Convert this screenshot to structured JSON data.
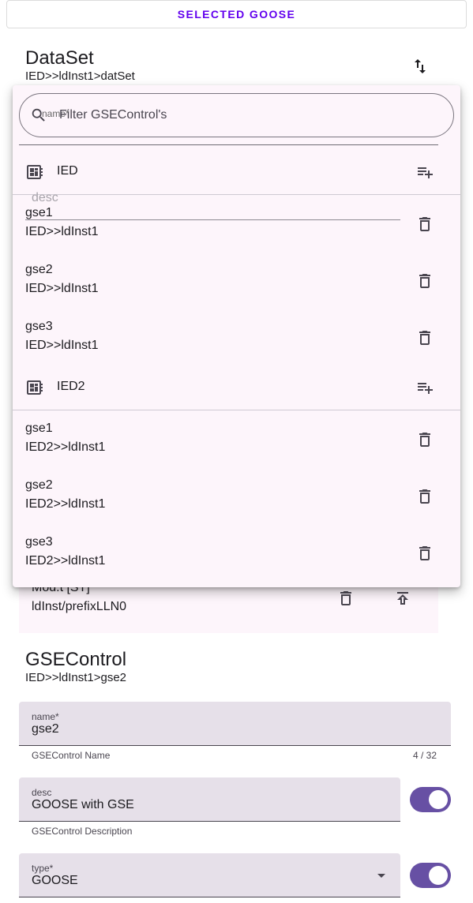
{
  "selected_button": "SELECTED GOOSE",
  "dataset": {
    "title": "DataSet",
    "path": "IED>>ldInst1>datSet"
  },
  "background_row": {
    "title": "Mod.t [ST]",
    "subtitle": "ldInst/prefixLLN0"
  },
  "popup": {
    "filter_label": "name*",
    "filter_placeholder": "Filter GSEControl's",
    "ghost_field_label": "desc",
    "groups": [
      {
        "label": "IED",
        "items": [
          {
            "title": "gse1",
            "subtitle": "IED>>ldInst1"
          },
          {
            "title": "gse2",
            "subtitle": "IED>>ldInst1"
          },
          {
            "title": "gse3",
            "subtitle": "IED>>ldInst1"
          }
        ]
      },
      {
        "label": "IED2",
        "items": [
          {
            "title": "gse1",
            "subtitle": "IED2>>ldInst1"
          },
          {
            "title": "gse2",
            "subtitle": "IED2>>ldInst1"
          },
          {
            "title": "gse3",
            "subtitle": "IED2>>ldInst1"
          }
        ]
      }
    ]
  },
  "gsecontrol": {
    "title": "GSEControl",
    "path": "IED>>ldInst1>gse2",
    "name_field": {
      "label": "name*",
      "value": "gse2",
      "helper": "GSEControl Name",
      "counter": "4 / 32"
    },
    "desc_field": {
      "label": "desc",
      "value": "GOOSE with GSE",
      "helper": "GSEControl Description",
      "toggle_on": true
    },
    "type_field": {
      "label": "type*",
      "value": "GOOSE",
      "toggle_on": true
    }
  },
  "colors": {
    "accent": "#6200ee",
    "toggle": "#6750a4",
    "popup_bg": "#fdf5fb",
    "field_bg": "#e6e0e9"
  },
  "icons": {
    "swap": "swap-vert-icon",
    "search": "search-icon",
    "ied": "developer-board-icon",
    "add": "playlist-add-icon",
    "delete": "delete-icon",
    "upload": "publish-icon"
  }
}
